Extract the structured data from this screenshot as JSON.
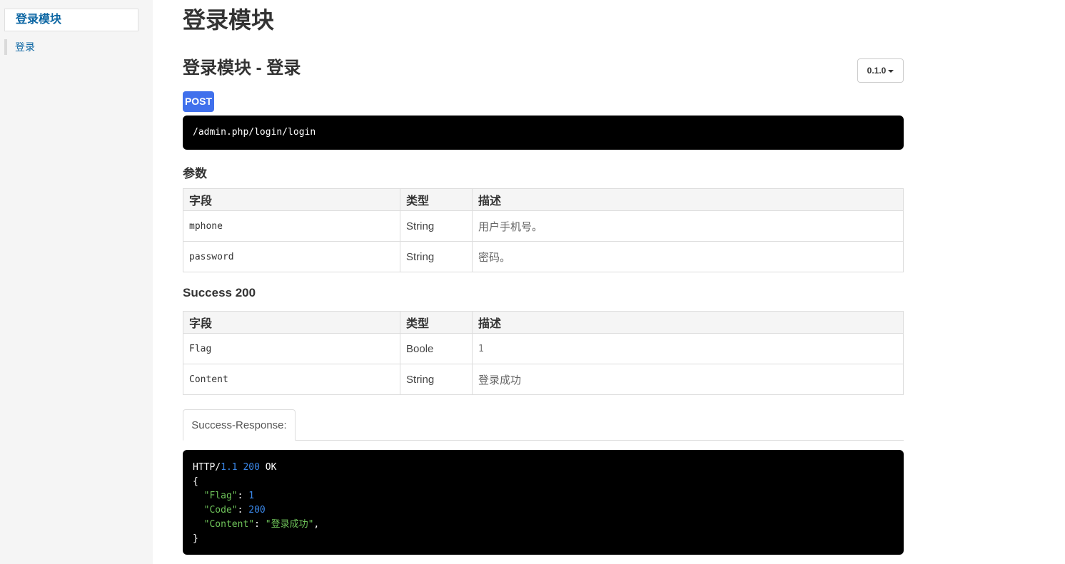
{
  "sidebar": {
    "header": "登录模块",
    "items": [
      {
        "label": "登录"
      }
    ]
  },
  "main": {
    "page_title": "登录模块",
    "section_title": "登录模块 - 登录",
    "version": "0.1.0",
    "method": "POST",
    "url": "/admin.php/login/login",
    "params": {
      "title": "参数",
      "headers": [
        "字段",
        "类型",
        "描述"
      ],
      "rows": [
        {
          "field": "mphone",
          "type": "String",
          "desc": "用户手机号。"
        },
        {
          "field": "password",
          "type": "String",
          "desc": "密码。"
        }
      ]
    },
    "success": {
      "title": "Success 200",
      "headers": [
        "字段",
        "类型",
        "描述"
      ],
      "rows": [
        {
          "field": "Flag",
          "type": "Boole",
          "desc": "1"
        },
        {
          "field": "Content",
          "type": "String",
          "desc": "登录成功"
        }
      ]
    },
    "tab_label": "Success-Response:",
    "response": {
      "status_prefix": "HTTP/",
      "status_version": "1.1",
      "status_code": "200",
      "status_text": "OK",
      "open_brace": "{",
      "close_brace": "}",
      "lines": [
        {
          "key": "\"Flag\"",
          "value": "1"
        },
        {
          "key": "\"Code\"",
          "value": "200"
        },
        {
          "key": "\"Content\"",
          "value": "\"登录成功\""
        }
      ]
    }
  },
  "colors": {
    "accent": "#0c66a3",
    "method_badge": "#4070ec",
    "code_bg": "#000000",
    "number": "#3a87e8",
    "string": "#6fc45a"
  }
}
